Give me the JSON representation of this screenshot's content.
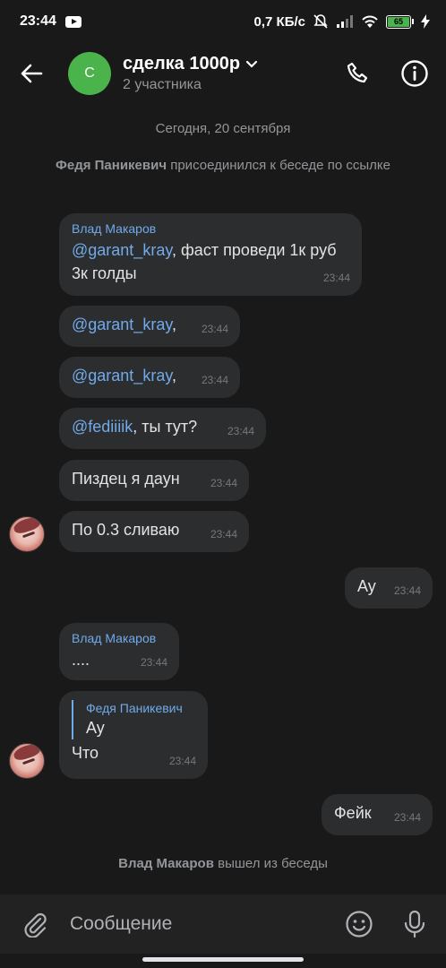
{
  "status_bar": {
    "time": "23:44",
    "network_speed": "0,7 КБ/с",
    "battery": "65"
  },
  "header": {
    "avatar_letter": "С",
    "title": "сделка 1000р",
    "subtitle": "2 участника"
  },
  "date_divider": "Сегодня, 20 сентября",
  "service": {
    "joined_name": "Федя Паникевич",
    "joined_text": "присоединился к беседе по ссылке",
    "left_name": "Влад Макаров",
    "left_text": "вышел из беседы"
  },
  "messages": [
    {
      "sender": "Влад Макаров",
      "mention": "@garant_kray",
      "text": ", фаст проведи 1к руб 3к голды",
      "time": "23:44"
    },
    {
      "mention": "@garant_kray",
      "text": ",",
      "time": "23:44"
    },
    {
      "mention": "@garant_kray",
      "text": ",",
      "time": "23:44"
    },
    {
      "mention": "@fediiiik",
      "text": ", ты тут?",
      "time": "23:44"
    },
    {
      "text": "Пиздец я даун",
      "time": "23:44"
    },
    {
      "text": "По 0.3 сливаю",
      "time": "23:44"
    },
    {
      "text": "Ау",
      "time": "23:44",
      "outgoing": true
    },
    {
      "sender": "Влад Макаров",
      "text": "....",
      "time": "23:44"
    },
    {
      "reply_sender": "Федя Паникевич",
      "reply_text": "Ау",
      "text": "Что",
      "time": "23:44"
    },
    {
      "text": "Фейк",
      "time": "23:44",
      "outgoing": true
    }
  ],
  "composer": {
    "placeholder": "Сообщение"
  },
  "colors": {
    "background": "#19191a",
    "bubble": "#2c2d2e",
    "accent": "#71aaeb",
    "avatar_green": "#4bb34b"
  },
  "icons": [
    "back-arrow-icon",
    "chevron-down-icon",
    "phone-icon",
    "info-icon",
    "attach-icon",
    "emoji-icon",
    "microphone-icon"
  ]
}
